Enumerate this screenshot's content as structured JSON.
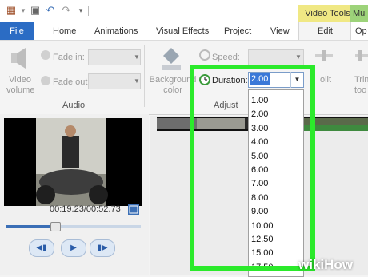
{
  "context_tabs": {
    "video_tools": "Video Tools",
    "music": "Mu"
  },
  "tabs": [
    "File",
    "Home",
    "Animations",
    "Visual Effects",
    "Project",
    "View",
    "Edit",
    "Op"
  ],
  "ribbon": {
    "video_volume": "Video volume",
    "fade_in": "Fade in:",
    "fade_out": "Fade out:",
    "audio_group": "Audio",
    "background_color": "Background color",
    "speed": "Speed:",
    "duration": "Duration:",
    "adjust_group": "Adjust",
    "split_partial": "olit",
    "trim_partial": "Trim too"
  },
  "duration_dropdown": {
    "selected": "2.00",
    "options": [
      "1.00",
      "2.00",
      "3.00",
      "4.00",
      "5.00",
      "6.00",
      "7.00",
      "8.00",
      "9.00",
      "10.00",
      "12.50",
      "15.00",
      "17.50"
    ]
  },
  "player": {
    "time": "00:19.23/00:52.73",
    "progress": 0.36
  },
  "watermark": "wikiHow",
  "colors": {
    "file_tab": "#2b6cc4",
    "highlight": "#2bea2b",
    "selection": "#3a78d8",
    "video_tools": "#f0e884",
    "music": "#9dd37a"
  }
}
